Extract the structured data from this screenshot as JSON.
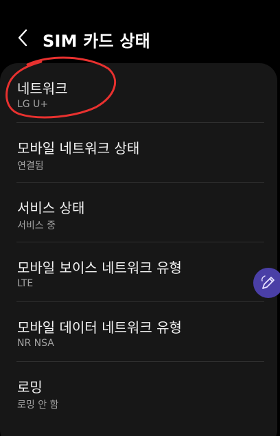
{
  "header": {
    "title": "SIM 카드 상태"
  },
  "items": [
    {
      "title": "네트워크",
      "subtitle": "LG U+"
    },
    {
      "title": "모바일 네트워크 상태",
      "subtitle": "연결됨"
    },
    {
      "title": "서비스 상태",
      "subtitle": "서비스 중"
    },
    {
      "title": "모바일 보이스 네트워크 유형",
      "subtitle": "LTE"
    },
    {
      "title": "모바일 데이터 네트워크 유형",
      "subtitle": "NR NSA"
    },
    {
      "title": "로밍",
      "subtitle": "로밍 안 함"
    }
  ],
  "colors": {
    "background": "#000000",
    "card": "#171717",
    "annotation": "#e8312f",
    "floating_button": "#4a3fa6"
  },
  "icons": {
    "back": "chevron-left-icon",
    "floating": "pen-icon"
  }
}
